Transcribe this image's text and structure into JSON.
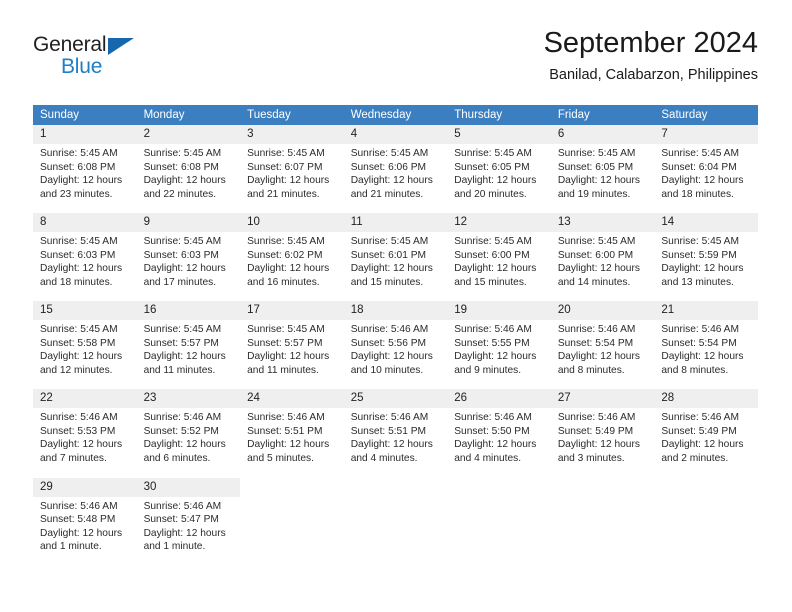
{
  "brand": {
    "name_part1": "General",
    "name_part2": "Blue",
    "flag_icon": "triangle-flag-icon"
  },
  "header": {
    "month_title": "September 2024",
    "location": "Banilad, Calabarzon, Philippines"
  },
  "colors": {
    "header_blue": "#3c7fc0",
    "row_border_blue": "#1f6cb0",
    "daynum_band": "#efefef",
    "brand_blue": "#1f7fc4",
    "text": "#2b2b2b"
  },
  "calendar": {
    "weekday_headers": [
      "Sunday",
      "Monday",
      "Tuesday",
      "Wednesday",
      "Thursday",
      "Friday",
      "Saturday"
    ],
    "weeks": [
      [
        {
          "day": "1",
          "sunrise": "Sunrise: 5:45 AM",
          "sunset": "Sunset: 6:08 PM",
          "daylight_line1": "Daylight: 12 hours",
          "daylight_line2": "and 23 minutes."
        },
        {
          "day": "2",
          "sunrise": "Sunrise: 5:45 AM",
          "sunset": "Sunset: 6:08 PM",
          "daylight_line1": "Daylight: 12 hours",
          "daylight_line2": "and 22 minutes."
        },
        {
          "day": "3",
          "sunrise": "Sunrise: 5:45 AM",
          "sunset": "Sunset: 6:07 PM",
          "daylight_line1": "Daylight: 12 hours",
          "daylight_line2": "and 21 minutes."
        },
        {
          "day": "4",
          "sunrise": "Sunrise: 5:45 AM",
          "sunset": "Sunset: 6:06 PM",
          "daylight_line1": "Daylight: 12 hours",
          "daylight_line2": "and 21 minutes."
        },
        {
          "day": "5",
          "sunrise": "Sunrise: 5:45 AM",
          "sunset": "Sunset: 6:05 PM",
          "daylight_line1": "Daylight: 12 hours",
          "daylight_line2": "and 20 minutes."
        },
        {
          "day": "6",
          "sunrise": "Sunrise: 5:45 AM",
          "sunset": "Sunset: 6:05 PM",
          "daylight_line1": "Daylight: 12 hours",
          "daylight_line2": "and 19 minutes."
        },
        {
          "day": "7",
          "sunrise": "Sunrise: 5:45 AM",
          "sunset": "Sunset: 6:04 PM",
          "daylight_line1": "Daylight: 12 hours",
          "daylight_line2": "and 18 minutes."
        }
      ],
      [
        {
          "day": "8",
          "sunrise": "Sunrise: 5:45 AM",
          "sunset": "Sunset: 6:03 PM",
          "daylight_line1": "Daylight: 12 hours",
          "daylight_line2": "and 18 minutes."
        },
        {
          "day": "9",
          "sunrise": "Sunrise: 5:45 AM",
          "sunset": "Sunset: 6:03 PM",
          "daylight_line1": "Daylight: 12 hours",
          "daylight_line2": "and 17 minutes."
        },
        {
          "day": "10",
          "sunrise": "Sunrise: 5:45 AM",
          "sunset": "Sunset: 6:02 PM",
          "daylight_line1": "Daylight: 12 hours",
          "daylight_line2": "and 16 minutes."
        },
        {
          "day": "11",
          "sunrise": "Sunrise: 5:45 AM",
          "sunset": "Sunset: 6:01 PM",
          "daylight_line1": "Daylight: 12 hours",
          "daylight_line2": "and 15 minutes."
        },
        {
          "day": "12",
          "sunrise": "Sunrise: 5:45 AM",
          "sunset": "Sunset: 6:00 PM",
          "daylight_line1": "Daylight: 12 hours",
          "daylight_line2": "and 15 minutes."
        },
        {
          "day": "13",
          "sunrise": "Sunrise: 5:45 AM",
          "sunset": "Sunset: 6:00 PM",
          "daylight_line1": "Daylight: 12 hours",
          "daylight_line2": "and 14 minutes."
        },
        {
          "day": "14",
          "sunrise": "Sunrise: 5:45 AM",
          "sunset": "Sunset: 5:59 PM",
          "daylight_line1": "Daylight: 12 hours",
          "daylight_line2": "and 13 minutes."
        }
      ],
      [
        {
          "day": "15",
          "sunrise": "Sunrise: 5:45 AM",
          "sunset": "Sunset: 5:58 PM",
          "daylight_line1": "Daylight: 12 hours",
          "daylight_line2": "and 12 minutes."
        },
        {
          "day": "16",
          "sunrise": "Sunrise: 5:45 AM",
          "sunset": "Sunset: 5:57 PM",
          "daylight_line1": "Daylight: 12 hours",
          "daylight_line2": "and 11 minutes."
        },
        {
          "day": "17",
          "sunrise": "Sunrise: 5:45 AM",
          "sunset": "Sunset: 5:57 PM",
          "daylight_line1": "Daylight: 12 hours",
          "daylight_line2": "and 11 minutes."
        },
        {
          "day": "18",
          "sunrise": "Sunrise: 5:46 AM",
          "sunset": "Sunset: 5:56 PM",
          "daylight_line1": "Daylight: 12 hours",
          "daylight_line2": "and 10 minutes."
        },
        {
          "day": "19",
          "sunrise": "Sunrise: 5:46 AM",
          "sunset": "Sunset: 5:55 PM",
          "daylight_line1": "Daylight: 12 hours",
          "daylight_line2": "and 9 minutes."
        },
        {
          "day": "20",
          "sunrise": "Sunrise: 5:46 AM",
          "sunset": "Sunset: 5:54 PM",
          "daylight_line1": "Daylight: 12 hours",
          "daylight_line2": "and 8 minutes."
        },
        {
          "day": "21",
          "sunrise": "Sunrise: 5:46 AM",
          "sunset": "Sunset: 5:54 PM",
          "daylight_line1": "Daylight: 12 hours",
          "daylight_line2": "and 8 minutes."
        }
      ],
      [
        {
          "day": "22",
          "sunrise": "Sunrise: 5:46 AM",
          "sunset": "Sunset: 5:53 PM",
          "daylight_line1": "Daylight: 12 hours",
          "daylight_line2": "and 7 minutes."
        },
        {
          "day": "23",
          "sunrise": "Sunrise: 5:46 AM",
          "sunset": "Sunset: 5:52 PM",
          "daylight_line1": "Daylight: 12 hours",
          "daylight_line2": "and 6 minutes."
        },
        {
          "day": "24",
          "sunrise": "Sunrise: 5:46 AM",
          "sunset": "Sunset: 5:51 PM",
          "daylight_line1": "Daylight: 12 hours",
          "daylight_line2": "and 5 minutes."
        },
        {
          "day": "25",
          "sunrise": "Sunrise: 5:46 AM",
          "sunset": "Sunset: 5:51 PM",
          "daylight_line1": "Daylight: 12 hours",
          "daylight_line2": "and 4 minutes."
        },
        {
          "day": "26",
          "sunrise": "Sunrise: 5:46 AM",
          "sunset": "Sunset: 5:50 PM",
          "daylight_line1": "Daylight: 12 hours",
          "daylight_line2": "and 4 minutes."
        },
        {
          "day": "27",
          "sunrise": "Sunrise: 5:46 AM",
          "sunset": "Sunset: 5:49 PM",
          "daylight_line1": "Daylight: 12 hours",
          "daylight_line2": "and 3 minutes."
        },
        {
          "day": "28",
          "sunrise": "Sunrise: 5:46 AM",
          "sunset": "Sunset: 5:49 PM",
          "daylight_line1": "Daylight: 12 hours",
          "daylight_line2": "and 2 minutes."
        }
      ],
      [
        {
          "day": "29",
          "sunrise": "Sunrise: 5:46 AM",
          "sunset": "Sunset: 5:48 PM",
          "daylight_line1": "Daylight: 12 hours",
          "daylight_line2": "and 1 minute."
        },
        {
          "day": "30",
          "sunrise": "Sunrise: 5:46 AM",
          "sunset": "Sunset: 5:47 PM",
          "daylight_line1": "Daylight: 12 hours",
          "daylight_line2": "and 1 minute."
        },
        {
          "day": "",
          "sunrise": "",
          "sunset": "",
          "daylight_line1": "",
          "daylight_line2": "",
          "empty": true
        },
        {
          "day": "",
          "sunrise": "",
          "sunset": "",
          "daylight_line1": "",
          "daylight_line2": "",
          "empty": true
        },
        {
          "day": "",
          "sunrise": "",
          "sunset": "",
          "daylight_line1": "",
          "daylight_line2": "",
          "empty": true
        },
        {
          "day": "",
          "sunrise": "",
          "sunset": "",
          "daylight_line1": "",
          "daylight_line2": "",
          "empty": true
        },
        {
          "day": "",
          "sunrise": "",
          "sunset": "",
          "daylight_line1": "",
          "daylight_line2": "",
          "empty": true
        }
      ]
    ]
  }
}
